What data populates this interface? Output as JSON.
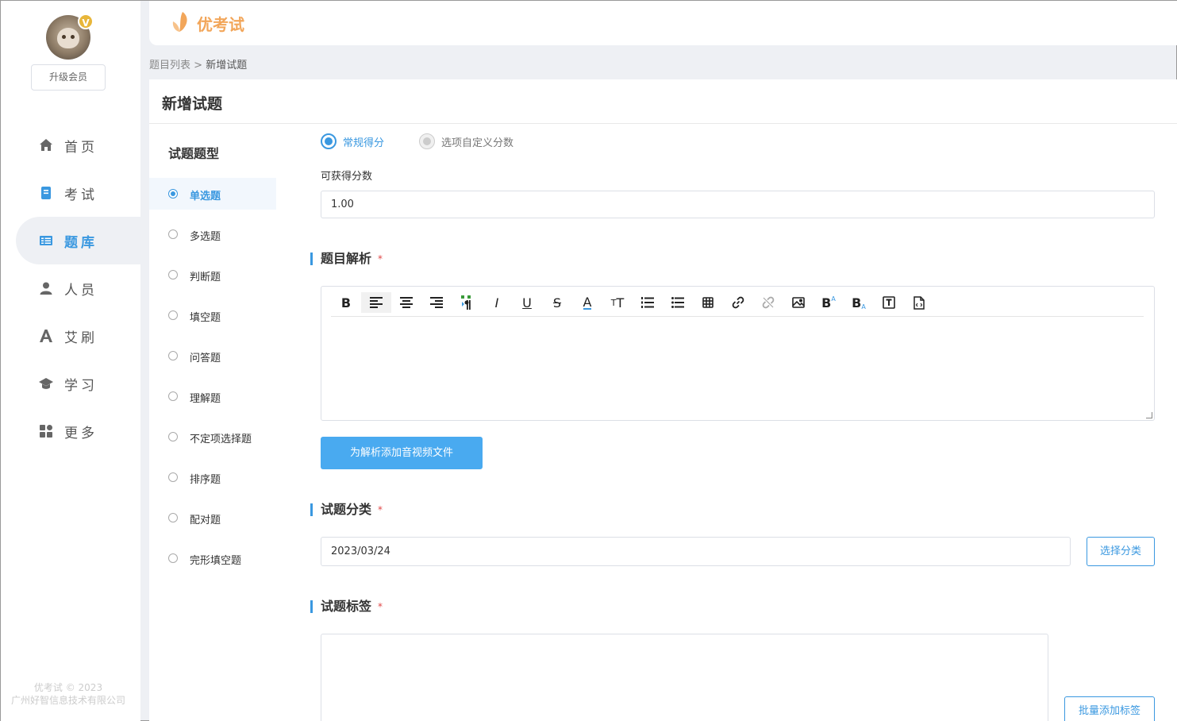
{
  "sidebar": {
    "vip_badge": "V",
    "upgrade_label": "升级会员",
    "items": [
      {
        "label": "首页",
        "icon": "home-icon"
      },
      {
        "label": "考试",
        "icon": "exam-icon"
      },
      {
        "label": "题库",
        "icon": "question-bank-icon"
      },
      {
        "label": "人员",
        "icon": "user-icon"
      },
      {
        "label": "艾刷",
        "icon": "font-a-icon"
      },
      {
        "label": "学习",
        "icon": "graduation-cap-icon"
      },
      {
        "label": "更多",
        "icon": "apps-icon"
      }
    ],
    "active_index": 2,
    "footer_line1": "优考试 © 2023",
    "footer_line2": "广州好智信息技术有限公司"
  },
  "header": {
    "logo_text": "优考试"
  },
  "breadcrumb": {
    "parent": "题目列表",
    "separator": " > ",
    "current": "新增试题"
  },
  "page_title": "新增试题",
  "question_types": {
    "title": "试题题型",
    "items": [
      "单选题",
      "多选题",
      "判断题",
      "填空题",
      "问答题",
      "理解题",
      "不定项选择题",
      "排序题",
      "配对题",
      "完形填空题"
    ],
    "selected": "单选题"
  },
  "scoring": {
    "option_normal": "常规得分",
    "option_custom": "选项自定义分数",
    "score_label": "可获得分数",
    "score_value": "1.00"
  },
  "analysis": {
    "title": "题目解析",
    "required_mark": "*",
    "add_media_label": "为解析添加音视频文件"
  },
  "category": {
    "title": "试题分类",
    "required_mark": "*",
    "value": "2023/03/24",
    "select_label": "选择分类"
  },
  "tags": {
    "title": "试题标签",
    "required_mark": "*",
    "batch_add_label": "批量添加标签"
  },
  "colors": {
    "accent": "#3a98e0",
    "button": "#49aaf0",
    "logo": "#f2a65a",
    "required": "#e04848"
  }
}
